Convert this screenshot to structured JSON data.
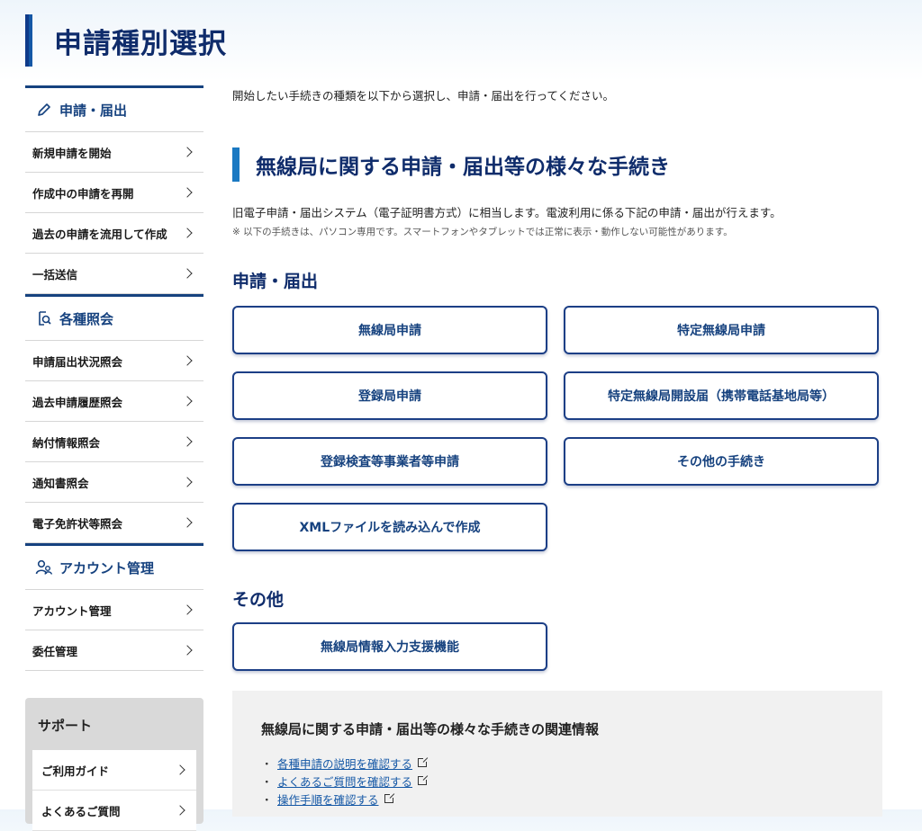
{
  "page": {
    "title": "申請種別選択"
  },
  "sidebar": {
    "sections": [
      {
        "title": "申請・届出",
        "icon": "pencil-icon",
        "items": [
          "新規申請を開始",
          "作成中の申請を再開",
          "過去の申請を流用して作成",
          "一括送信"
        ]
      },
      {
        "title": "各種照会",
        "icon": "document-search-icon",
        "items": [
          "申請届出状況照会",
          "過去申請履歴照会",
          "納付情報照会",
          "通知書照会",
          "電子免許状等照会"
        ]
      },
      {
        "title": "アカウント管理",
        "icon": "users-icon",
        "items": [
          "アカウント管理",
          "委任管理"
        ]
      }
    ],
    "support": {
      "title": "サポート",
      "items": [
        "ご利用ガイド",
        "よくあるご質問"
      ]
    }
  },
  "main": {
    "intro": "開始したい手続きの種類を以下から選択し、申請・届出を行ってください。",
    "section_title": "無線局に関する申請・届出等の様々な手続き",
    "description": "旧電子申請・届出システム（電子証明書方式）に相当します。電波利用に係る下記の申請・届出が行えます。",
    "note": "※ 以下の手続きは、パソコン専用です。スマートフォンやタブレットでは正常に表示・動作しない可能性があります。",
    "group1": {
      "title": "申請・届出",
      "buttons": [
        "無線局申請",
        "特定無線局申請",
        "登録局申請",
        "特定無線局開設届（携帯電話基地局等）",
        "登録検査等事業者等申請",
        "その他の手続き",
        "XMLファイルを読み込んで作成"
      ]
    },
    "group2": {
      "title": "その他",
      "buttons": [
        "無線局情報入力支援機能"
      ]
    },
    "related": {
      "title": "無線局に関する申請・届出等の様々な手続きの関連情報",
      "links": [
        "各種申請の説明を確認する",
        "よくあるご質問を確認する",
        "操作手順を確認する"
      ],
      "bullet": "・"
    }
  },
  "colors": {
    "primary": "#16427f",
    "accent": "#1b79c2",
    "border": "#1c3f86"
  }
}
